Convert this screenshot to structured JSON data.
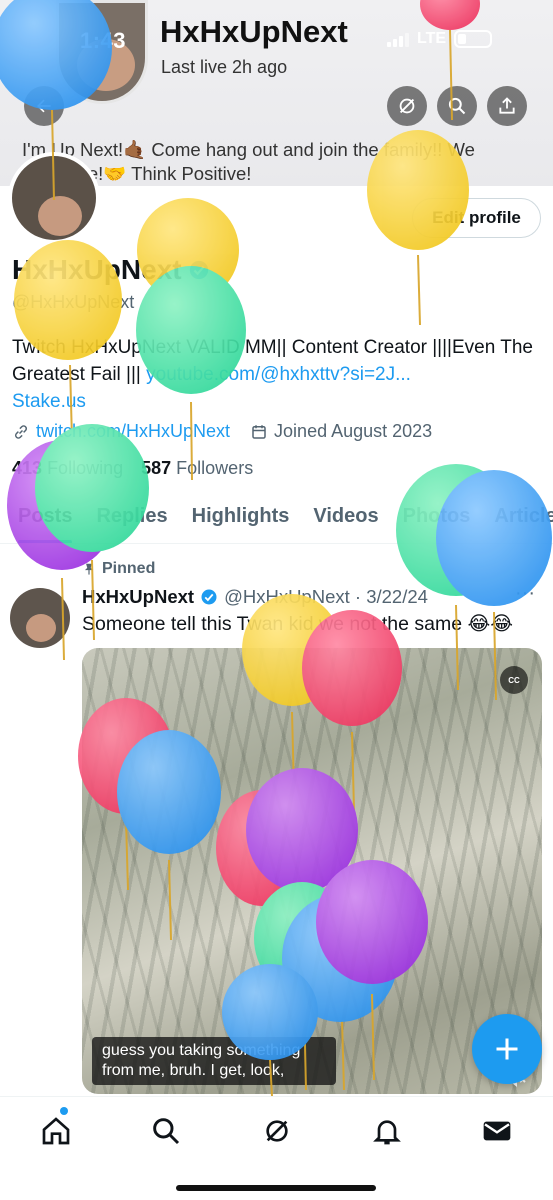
{
  "status_bar": {
    "time": "1:43",
    "network": "LTE"
  },
  "header": {
    "name": "HxHxUpNext",
    "subtitle": "Last live 2h ago"
  },
  "banner_bio": "I'm Up Next!🤙🏾 Come hang out and join the family!! We everyone!🤝 Think Positive!",
  "profile": {
    "edit_label": "Edit profile",
    "display_name": "HxHxUpNext",
    "handle": "@HxHxUpNext",
    "bio_text": "Twitch HxHxUpNext VALID MM|| Content Creator ||||Even The Greatest Fail ||| ",
    "bio_link": "youtube.com/@hxhxttv?si=2J...",
    "bio_link2": "Stake.us",
    "website": "twitch.com/HxHxUpNext",
    "joined": "Joined August 2023",
    "following_count": "413",
    "following_label": "Following",
    "followers_count": "587",
    "followers_label": "Followers"
  },
  "tabs": [
    {
      "label": "Posts"
    },
    {
      "label": "Replies"
    },
    {
      "label": "Highlights"
    },
    {
      "label": "Videos"
    },
    {
      "label": "Photos"
    },
    {
      "label": "Articles"
    }
  ],
  "post": {
    "pinned_label": "Pinned",
    "author": "HxHxUpNext",
    "handle_date": "@HxHxUpNext · 3/22/24",
    "text": "Someone tell this Twan kid we not the same 😂😂",
    "caption": "guess you taking something from me, bruh. I get, look,",
    "cc_label": "CC"
  },
  "colors": {
    "accent": "#1d9bf0",
    "text": "#0f1419",
    "muted": "#536471"
  },
  "icons": [
    "back-arrow-icon",
    "grok-icon",
    "search-icon",
    "share-icon",
    "link-icon",
    "calendar-icon",
    "pin-icon",
    "verified-icon",
    "plus-icon",
    "home-icon",
    "notifications-icon",
    "messages-icon"
  ]
}
